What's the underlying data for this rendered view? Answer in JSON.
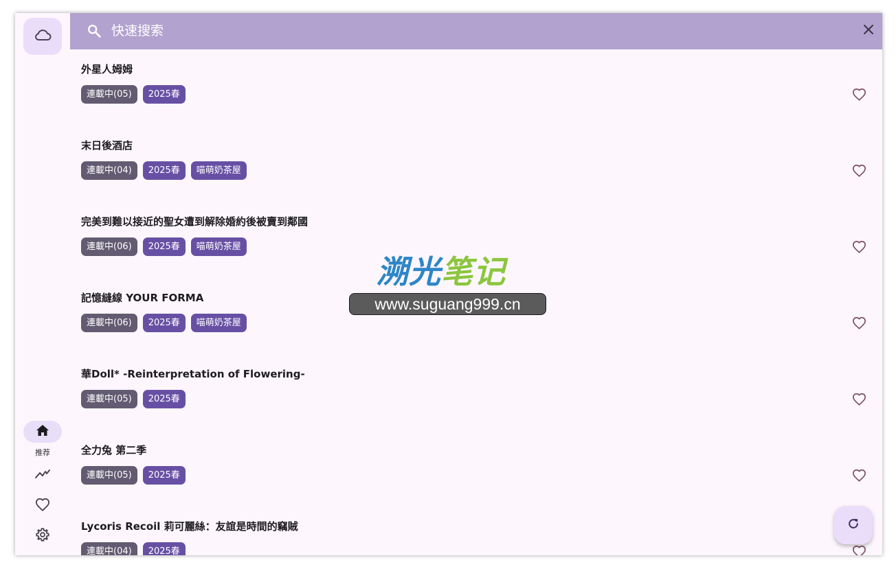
{
  "app": {
    "nav": {
      "home_label": "推荐"
    },
    "search": {
      "placeholder": "快速搜索"
    },
    "items": [
      {
        "title": "外星人姆姆",
        "status": "連載中(05)",
        "season": "2025春",
        "group": ""
      },
      {
        "title": "末日後酒店",
        "status": "連載中(04)",
        "season": "2025春",
        "group": "喵萌奶茶屋"
      },
      {
        "title": "完美到難以接近的聖女遭到解除婚約後被賣到鄰國",
        "status": "連載中(06)",
        "season": "2025春",
        "group": "喵萌奶茶屋"
      },
      {
        "title": "記憶縫線 YOUR FORMA",
        "status": "連載中(06)",
        "season": "2025春",
        "group": "喵萌奶茶屋"
      },
      {
        "title": "華Doll* -Reinterpretation of Flowering-",
        "status": "連載中(05)",
        "season": "2025春",
        "group": ""
      },
      {
        "title": "全力兔 第二季",
        "status": "連載中(05)",
        "season": "2025春",
        "group": ""
      },
      {
        "title": "Lycoris Recoil 莉可麗絲：友誼是時間的竊賊",
        "status": "連載中(04)",
        "season": "2025春",
        "group": ""
      }
    ]
  },
  "watermark": {
    "logo_part1": "溯光",
    "logo_part2": "笔记",
    "url": "www.suguang999.cn"
  },
  "colors": {
    "search_bar": "#b2a2cf",
    "tag_status": "#625b71",
    "tag_season": "#6750a4",
    "accent_container": "#eaddfa",
    "surface": "#fdf7fd",
    "heart": "#7d5260"
  },
  "icons": {
    "logo": "cloud-icon",
    "home": "home-icon",
    "trending": "trending-icon",
    "favorites": "heart-icon",
    "settings": "gear-icon",
    "search": "search-icon",
    "clear": "close-icon",
    "refresh": "refresh-icon"
  }
}
